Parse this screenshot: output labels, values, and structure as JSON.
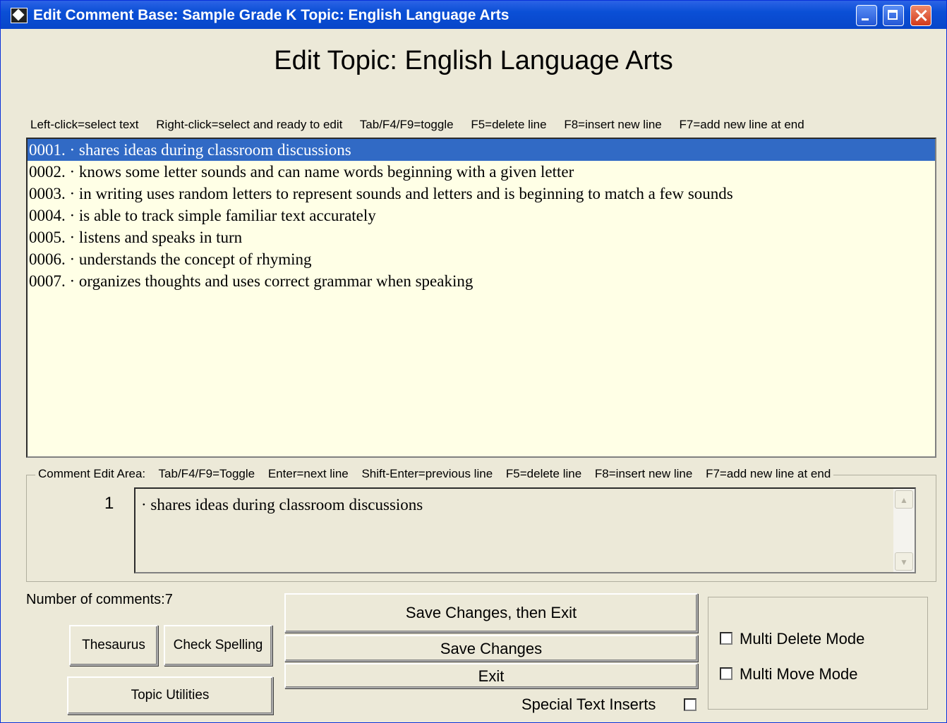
{
  "window": {
    "title": "Edit Comment Base: Sample Grade K  Topic: English Language Arts"
  },
  "heading": "Edit Topic: English Language Arts",
  "hints": [
    "Left-click=select text",
    "Right-click=select and ready to edit",
    "Tab/F4/F9=toggle",
    "F5=delete line",
    "F8=insert new line",
    "F7=add new line at end"
  ],
  "comments": [
    "0001. · shares ideas during classroom discussions",
    "0002. · knows some letter sounds and can name words beginning with a given letter",
    "0003. · in writing uses random letters to represent sounds and letters and is beginning to match a few sounds",
    "0004. · is able to track simple familiar text accurately",
    "0005. · listens and speaks in turn",
    "0006. · understands the concept of rhyming",
    "0007. · organizes thoughts and uses correct grammar when speaking"
  ],
  "selected_index": 0,
  "edit_area": {
    "legend": [
      "Comment Edit Area:",
      "Tab/F4/F9=Toggle",
      "Enter=next line",
      "Shift-Enter=previous line",
      "F5=delete line",
      "F8=insert new line",
      "F7=add new line at end"
    ],
    "line_number": "1",
    "text": "· shares ideas during classroom discussions"
  },
  "count_label": "Number of comments:7",
  "buttons": {
    "thesaurus": "Thesaurus",
    "check_spelling": "Check Spelling",
    "topic_utilities": "Topic Utilities",
    "save_then_exit": "Save Changes, then Exit",
    "save": "Save Changes",
    "exit": "Exit"
  },
  "options": {
    "special_text_inserts": "Special Text Inserts",
    "multi_delete": "Multi Delete Mode",
    "multi_move": "Multi Move Mode"
  },
  "colors": {
    "selection": "#316ac5",
    "list_background": "#ffffe6",
    "window_background": "#ece9d8"
  }
}
